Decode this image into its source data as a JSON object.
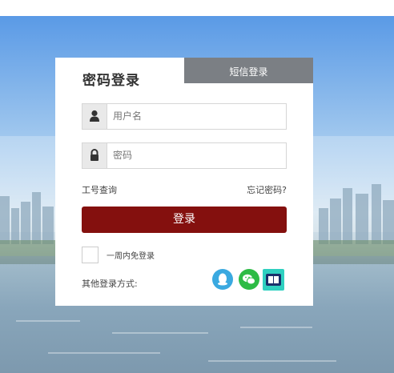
{
  "tabs": {
    "password_login": "密码登录",
    "sms_login": "短信登录"
  },
  "username": {
    "placeholder": "用户名",
    "icon": "user-icon"
  },
  "password": {
    "placeholder": "密码",
    "icon": "lock-icon"
  },
  "links": {
    "employee_id_lookup": "工号查询",
    "forgot_password": "忘记密码?"
  },
  "login_button": "登录",
  "remember_week": {
    "label": "一周内免登录",
    "checked": false
  },
  "other_login": {
    "label": "其他登录方式:",
    "providers": [
      "qq-icon",
      "wechat-icon",
      "app-icon"
    ]
  },
  "colors": {
    "login_button": "#84100e",
    "sms_tab": "#7b7f84",
    "qq": "#3aa9e0",
    "wechat": "#2dbb45",
    "app": "#2fd0c0"
  }
}
